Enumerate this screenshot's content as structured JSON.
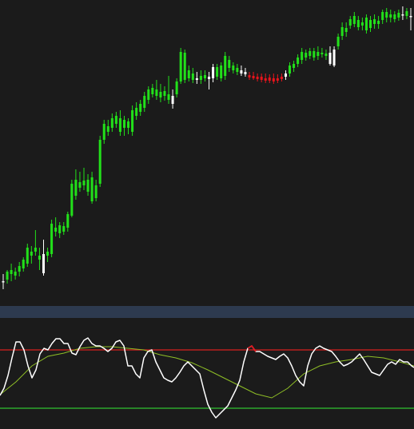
{
  "colors": {
    "background": "#1b1b1b",
    "separator": "#2d3a4f",
    "candle_up": "#22e01a",
    "candle_neutral": "#ffffff",
    "candle_down": "#e8141c",
    "osc_main": "#ffffff",
    "osc_main_oversold": "#e8141c",
    "osc_signal": "#8fbf26",
    "level_upper": "#d9201f",
    "level_lower": "#31c431"
  },
  "chart_data": [
    {
      "type": "candlestick",
      "title": "",
      "xlabel": "",
      "ylabel": "",
      "grid": false,
      "ylim": [
        0,
        383
      ],
      "candles": [
        {
          "o": 352,
          "h": 343,
          "l": 362,
          "c": 352,
          "k": "w"
        },
        {
          "o": 350,
          "h": 338,
          "l": 355,
          "c": 340,
          "k": "g"
        },
        {
          "o": 343,
          "h": 330,
          "l": 352,
          "c": 338,
          "k": "g"
        },
        {
          "o": 345,
          "h": 335,
          "l": 350,
          "c": 340,
          "k": "g"
        },
        {
          "o": 340,
          "h": 328,
          "l": 346,
          "c": 333,
          "k": "g"
        },
        {
          "o": 336,
          "h": 322,
          "l": 340,
          "c": 325,
          "k": "g"
        },
        {
          "o": 330,
          "h": 305,
          "l": 334,
          "c": 310,
          "k": "g"
        },
        {
          "o": 320,
          "h": 308,
          "l": 330,
          "c": 315,
          "k": "g"
        },
        {
          "o": 315,
          "h": 288,
          "l": 320,
          "c": 310,
          "k": "g"
        },
        {
          "o": 320,
          "h": 310,
          "l": 338,
          "c": 325,
          "k": "g"
        },
        {
          "o": 318,
          "h": 300,
          "l": 345,
          "c": 342,
          "k": "w"
        },
        {
          "o": 320,
          "h": 310,
          "l": 328,
          "c": 315,
          "k": "g"
        },
        {
          "o": 318,
          "h": 275,
          "l": 322,
          "c": 280,
          "k": "g"
        },
        {
          "o": 290,
          "h": 272,
          "l": 296,
          "c": 285,
          "k": "g"
        },
        {
          "o": 292,
          "h": 278,
          "l": 298,
          "c": 282,
          "k": "g"
        },
        {
          "o": 290,
          "h": 278,
          "l": 294,
          "c": 283,
          "k": "g"
        },
        {
          "o": 285,
          "h": 265,
          "l": 290,
          "c": 268,
          "k": "g"
        },
        {
          "o": 270,
          "h": 225,
          "l": 272,
          "c": 230,
          "k": "g"
        },
        {
          "o": 245,
          "h": 212,
          "l": 250,
          "c": 225,
          "k": "g"
        },
        {
          "o": 235,
          "h": 215,
          "l": 240,
          "c": 228,
          "k": "g"
        },
        {
          "o": 232,
          "h": 210,
          "l": 238,
          "c": 226,
          "k": "g"
        },
        {
          "o": 240,
          "h": 218,
          "l": 245,
          "c": 225,
          "k": "g"
        },
        {
          "o": 252,
          "h": 215,
          "l": 255,
          "c": 222,
          "k": "g"
        },
        {
          "o": 248,
          "h": 225,
          "l": 252,
          "c": 232,
          "k": "g"
        },
        {
          "o": 230,
          "h": 170,
          "l": 234,
          "c": 175,
          "k": "g"
        },
        {
          "o": 175,
          "h": 150,
          "l": 180,
          "c": 155,
          "k": "g"
        },
        {
          "o": 165,
          "h": 150,
          "l": 170,
          "c": 158,
          "k": "g"
        },
        {
          "o": 160,
          "h": 142,
          "l": 165,
          "c": 148,
          "k": "g"
        },
        {
          "o": 155,
          "h": 140,
          "l": 160,
          "c": 145,
          "k": "g"
        },
        {
          "o": 165,
          "h": 138,
          "l": 170,
          "c": 148,
          "k": "g"
        },
        {
          "o": 160,
          "h": 145,
          "l": 170,
          "c": 150,
          "k": "g"
        },
        {
          "o": 160,
          "h": 148,
          "l": 168,
          "c": 152,
          "k": "g"
        },
        {
          "o": 165,
          "h": 132,
          "l": 170,
          "c": 138,
          "k": "g"
        },
        {
          "o": 145,
          "h": 128,
          "l": 150,
          "c": 135,
          "k": "g"
        },
        {
          "o": 140,
          "h": 125,
          "l": 145,
          "c": 130,
          "k": "g"
        },
        {
          "o": 135,
          "h": 115,
          "l": 140,
          "c": 120,
          "k": "g"
        },
        {
          "o": 125,
          "h": 108,
          "l": 130,
          "c": 112,
          "k": "g"
        },
        {
          "o": 118,
          "h": 105,
          "l": 122,
          "c": 110,
          "k": "g"
        },
        {
          "o": 120,
          "h": 100,
          "l": 125,
          "c": 112,
          "k": "g"
        },
        {
          "o": 122,
          "h": 105,
          "l": 128,
          "c": 115,
          "k": "g"
        },
        {
          "o": 120,
          "h": 108,
          "l": 126,
          "c": 114,
          "k": "g"
        },
        {
          "o": 125,
          "h": 95,
          "l": 130,
          "c": 118,
          "k": "g"
        },
        {
          "o": 120,
          "h": 112,
          "l": 136,
          "c": 130,
          "k": "w"
        },
        {
          "o": 118,
          "h": 98,
          "l": 122,
          "c": 102,
          "k": "g"
        },
        {
          "o": 102,
          "h": 60,
          "l": 105,
          "c": 65,
          "k": "g"
        },
        {
          "o": 100,
          "h": 62,
          "l": 104,
          "c": 66,
          "k": "g"
        },
        {
          "o": 98,
          "h": 82,
          "l": 102,
          "c": 88,
          "k": "g"
        },
        {
          "o": 100,
          "h": 85,
          "l": 104,
          "c": 92,
          "k": "g"
        },
        {
          "o": 98,
          "h": 90,
          "l": 105,
          "c": 100,
          "k": "w"
        },
        {
          "o": 100,
          "h": 88,
          "l": 105,
          "c": 95,
          "k": "g"
        },
        {
          "o": 98,
          "h": 88,
          "l": 102,
          "c": 94,
          "k": "g"
        },
        {
          "o": 96,
          "h": 90,
          "l": 112,
          "c": 99,
          "k": "w"
        },
        {
          "o": 98,
          "h": 80,
          "l": 103,
          "c": 84,
          "k": "w"
        },
        {
          "o": 96,
          "h": 80,
          "l": 100,
          "c": 84,
          "k": "g"
        },
        {
          "o": 98,
          "h": 78,
          "l": 102,
          "c": 82,
          "k": "g"
        },
        {
          "o": 95,
          "h": 65,
          "l": 100,
          "c": 70,
          "k": "g"
        },
        {
          "o": 85,
          "h": 70,
          "l": 90,
          "c": 75,
          "k": "g"
        },
        {
          "o": 88,
          "h": 78,
          "l": 92,
          "c": 82,
          "k": "g"
        },
        {
          "o": 90,
          "h": 80,
          "l": 94,
          "c": 85,
          "k": "g"
        },
        {
          "o": 88,
          "h": 82,
          "l": 95,
          "c": 92,
          "k": "w"
        },
        {
          "o": 90,
          "h": 85,
          "l": 96,
          "c": 93,
          "k": "w"
        },
        {
          "o": 94,
          "h": 90,
          "l": 100,
          "c": 97,
          "k": "r"
        },
        {
          "o": 95,
          "h": 90,
          "l": 100,
          "c": 98,
          "k": "r"
        },
        {
          "o": 96,
          "h": 92,
          "l": 102,
          "c": 99,
          "k": "r"
        },
        {
          "o": 96,
          "h": 92,
          "l": 103,
          "c": 100,
          "k": "r"
        },
        {
          "o": 98,
          "h": 92,
          "l": 104,
          "c": 101,
          "k": "r"
        },
        {
          "o": 97,
          "h": 93,
          "l": 104,
          "c": 101,
          "k": "r"
        },
        {
          "o": 98,
          "h": 92,
          "l": 105,
          "c": 102,
          "k": "r"
        },
        {
          "o": 98,
          "h": 93,
          "l": 104,
          "c": 101,
          "k": "r"
        },
        {
          "o": 96,
          "h": 92,
          "l": 102,
          "c": 99,
          "k": "r"
        },
        {
          "o": 96,
          "h": 88,
          "l": 100,
          "c": 92,
          "k": "w"
        },
        {
          "o": 92,
          "h": 78,
          "l": 96,
          "c": 82,
          "k": "g"
        },
        {
          "o": 85,
          "h": 76,
          "l": 90,
          "c": 80,
          "k": "g"
        },
        {
          "o": 80,
          "h": 68,
          "l": 84,
          "c": 72,
          "k": "g"
        },
        {
          "o": 75,
          "h": 60,
          "l": 80,
          "c": 65,
          "k": "g"
        },
        {
          "o": 72,
          "h": 62,
          "l": 76,
          "c": 66,
          "k": "g"
        },
        {
          "o": 70,
          "h": 60,
          "l": 74,
          "c": 64,
          "k": "g"
        },
        {
          "o": 72,
          "h": 60,
          "l": 76,
          "c": 64,
          "k": "g"
        },
        {
          "o": 70,
          "h": 58,
          "l": 75,
          "c": 65,
          "k": "g"
        },
        {
          "o": 68,
          "h": 60,
          "l": 72,
          "c": 66,
          "k": "g"
        },
        {
          "o": 70,
          "h": 62,
          "l": 75,
          "c": 67,
          "k": "g"
        },
        {
          "o": 66,
          "h": 58,
          "l": 82,
          "c": 80,
          "k": "w"
        },
        {
          "o": 62,
          "h": 58,
          "l": 84,
          "c": 82,
          "k": "w"
        },
        {
          "o": 58,
          "h": 42,
          "l": 62,
          "c": 46,
          "k": "g"
        },
        {
          "o": 45,
          "h": 28,
          "l": 50,
          "c": 34,
          "k": "g"
        },
        {
          "o": 35,
          "h": 28,
          "l": 46,
          "c": 40,
          "k": "g"
        },
        {
          "o": 32,
          "h": 20,
          "l": 36,
          "c": 24,
          "k": "g"
        },
        {
          "o": 30,
          "h": 15,
          "l": 34,
          "c": 20,
          "k": "g"
        },
        {
          "o": 34,
          "h": 20,
          "l": 38,
          "c": 25,
          "k": "g"
        },
        {
          "o": 32,
          "h": 22,
          "l": 38,
          "c": 28,
          "k": "g"
        },
        {
          "o": 38,
          "h": 18,
          "l": 42,
          "c": 22,
          "k": "g"
        },
        {
          "o": 35,
          "h": 20,
          "l": 40,
          "c": 25,
          "k": "g"
        },
        {
          "o": 30,
          "h": 18,
          "l": 36,
          "c": 24,
          "k": "g"
        },
        {
          "o": 30,
          "h": 20,
          "l": 36,
          "c": 26,
          "k": "g"
        },
        {
          "o": 25,
          "h": 12,
          "l": 30,
          "c": 15,
          "k": "g"
        },
        {
          "o": 22,
          "h": 10,
          "l": 28,
          "c": 15,
          "k": "g"
        },
        {
          "o": 22,
          "h": 12,
          "l": 28,
          "c": 18,
          "k": "g"
        },
        {
          "o": 24,
          "h": 14,
          "l": 28,
          "c": 18,
          "k": "g"
        },
        {
          "o": 22,
          "h": 12,
          "l": 26,
          "c": 16,
          "k": "g"
        },
        {
          "o": 18,
          "h": 8,
          "l": 25,
          "c": 18,
          "k": "w"
        },
        {
          "o": 20,
          "h": 10,
          "l": 24,
          "c": 14,
          "k": "g"
        },
        {
          "o": 20,
          "h": 10,
          "l": 38,
          "c": 20,
          "k": "w"
        }
      ]
    },
    {
      "type": "line",
      "title": "",
      "xlabel": "",
      "ylabel": "",
      "grid": false,
      "ylim": [
        0,
        139
      ],
      "levels": [
        {
          "name": "upper",
          "value": 40
        },
        {
          "name": "lower",
          "value": 113
        }
      ],
      "series": [
        {
          "role": "main",
          "x": [
            0,
            5,
            10,
            15,
            20,
            25,
            30,
            35,
            40,
            45,
            50,
            55,
            60,
            65,
            70,
            75,
            80,
            85,
            90,
            95,
            100,
            105,
            110,
            115,
            120,
            125,
            130,
            135,
            140,
            145,
            150,
            155,
            160,
            165,
            170,
            175,
            180,
            185,
            190,
            195,
            200,
            205,
            210,
            215,
            220,
            225,
            230,
            235,
            240,
            245,
            250,
            255,
            260,
            265,
            270,
            275,
            280,
            285,
            290,
            295,
            300,
            305,
            310,
            315,
            320,
            325,
            330,
            335,
            340,
            345,
            350,
            355,
            360,
            365,
            370,
            375,
            380,
            385,
            390,
            395,
            400,
            405,
            410,
            415,
            420,
            425,
            430,
            435,
            440,
            445,
            450,
            455,
            460,
            465,
            470,
            475,
            480,
            485,
            490,
            495,
            500,
            505,
            510,
            515,
            518
          ],
          "y": [
            97,
            88,
            72,
            50,
            30,
            30,
            40,
            60,
            75,
            65,
            45,
            38,
            40,
            32,
            26,
            26,
            32,
            32,
            44,
            46,
            36,
            28,
            25,
            32,
            35,
            35,
            38,
            42,
            38,
            30,
            28,
            35,
            60,
            60,
            70,
            75,
            50,
            42,
            40,
            55,
            65,
            75,
            78,
            80,
            75,
            68,
            60,
            55,
            60,
            65,
            70,
            90,
            108,
            118,
            125,
            120,
            115,
            110,
            100,
            90,
            78,
            55,
            38,
            35,
            42,
            42,
            45,
            48,
            50,
            52,
            48,
            45,
            50,
            60,
            72,
            80,
            85,
            60,
            45,
            38,
            35,
            38,
            40,
            42,
            48,
            55,
            60,
            58,
            55,
            50,
            45,
            52,
            60,
            68,
            70,
            72,
            65,
            58,
            55,
            58,
            52,
            55,
            55,
            60,
            62
          ],
          "oversold_from_x": 310,
          "oversold_to_x": 320
        },
        {
          "role": "signal",
          "x": [
            0,
            20,
            40,
            60,
            80,
            100,
            120,
            140,
            160,
            180,
            200,
            220,
            240,
            260,
            280,
            300,
            320,
            340,
            360,
            380,
            400,
            420,
            440,
            460,
            480,
            500,
            518
          ],
          "y": [
            96,
            80,
            60,
            48,
            44,
            38,
            36,
            36,
            38,
            40,
            46,
            50,
            56,
            65,
            75,
            85,
            95,
            100,
            88,
            70,
            60,
            55,
            52,
            48,
            50,
            55,
            60
          ]
        }
      ]
    }
  ]
}
